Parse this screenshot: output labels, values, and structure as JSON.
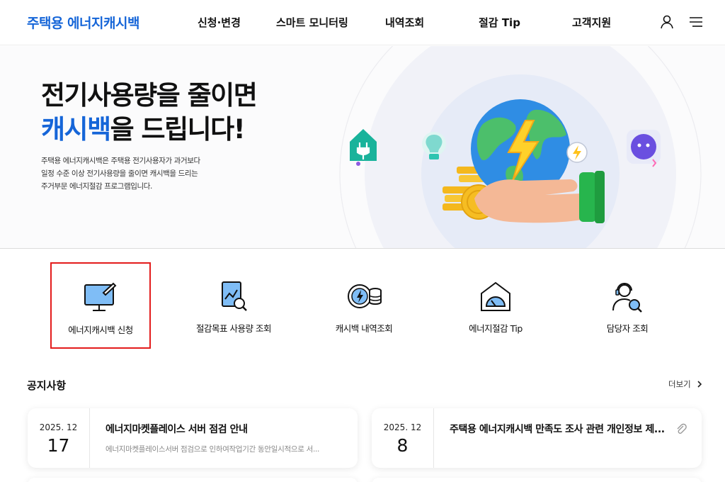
{
  "header": {
    "logo": "주택용 에너지캐시백",
    "nav": [
      "신청·변경",
      "스마트 모니터링",
      "내역조회",
      "절감 Tip",
      "고객지원"
    ],
    "icons": [
      "user-icon",
      "menu-icon"
    ]
  },
  "hero": {
    "title_line1": "전기사용량을 줄이면",
    "title_highlight": "캐시백",
    "title_line2_rest": "을 드립니다!",
    "desc_lines": [
      "주택용 에너지캐시백은 주택용 전기사용자가 과거보다",
      "일정 수준 이상 전기사용량을 줄이면 캐시백을 드리는",
      "주거부문 에너지절감 프로그램입니다."
    ],
    "colors": {
      "highlight": "#1565d8"
    }
  },
  "quick_menu": [
    {
      "label": "에너지캐시백 신청",
      "icon": "monitor-pen-icon",
      "selected": true
    },
    {
      "label": "절감목표 사용량 조회",
      "icon": "report-search-icon"
    },
    {
      "label": "캐시백 내역조회",
      "icon": "coin-stack-icon"
    },
    {
      "label": "에너지절감 Tip",
      "icon": "gauge-house-icon"
    },
    {
      "label": "담당자 조회",
      "icon": "agent-search-icon"
    }
  ],
  "notices": {
    "title": "공지사항",
    "more": "더보기",
    "items": [
      {
        "year_month": "2025. 12",
        "day": "17",
        "title": "에너지마켓플레이스 서버 점검 안내",
        "summary": "에너지마켓플레이스서버 점검으로 인하여작업기간 동안일시적으로 서..."
      },
      {
        "year_month": "2025. 12",
        "day": "8",
        "title": "주택용 에너지캐시백 만족도 조사 관련 개인정보 제...",
        "summary": "",
        "attachment_icon": "paperclip-icon"
      }
    ]
  }
}
